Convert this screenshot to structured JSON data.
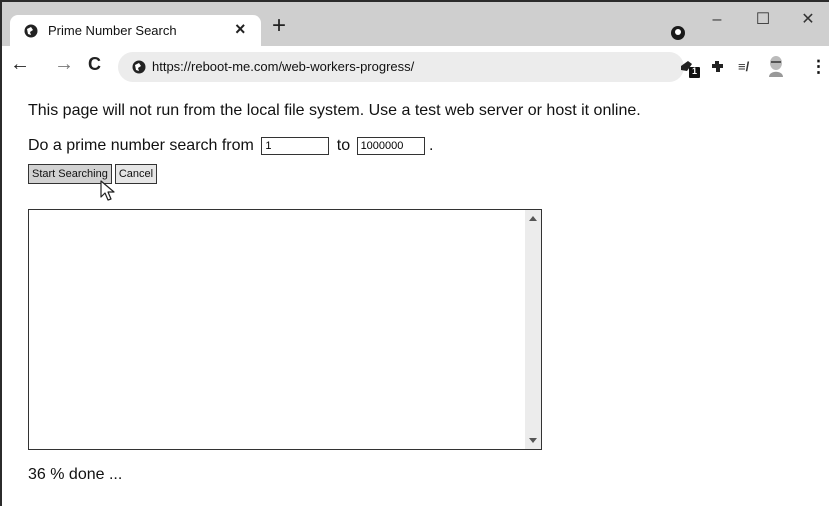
{
  "browser": {
    "tab_title": "Prime Number Search",
    "tab_close": "×",
    "new_tab": "+",
    "url": "https://reboot-me.com/web-workers-progress/",
    "window_controls": {
      "minimize": "–",
      "maximize": "☐",
      "close": "✕"
    },
    "nav": {
      "back": "←",
      "forward": "→",
      "reload": "C"
    },
    "toolbar_icons": [
      "extension-badge-icon",
      "puzzle-extensions-icon",
      "reading-list-icon",
      "profile-avatar-icon",
      "kebab-menu-icon"
    ],
    "toolbar_badge": "1",
    "menu_glyph": "⋮",
    "reading_list_glyph": "≡/"
  },
  "page": {
    "intro_text": "This page will not run from the local file system. Use a test web server or host it online.",
    "range_prefix": "Do a prime number search from",
    "from_value": "1",
    "range_middle": "to",
    "to_value": "1000000",
    "range_suffix": ".",
    "start_button": "Start Searching",
    "cancel_button": "Cancel",
    "results_text": "",
    "status_text": "36 % done ..."
  }
}
